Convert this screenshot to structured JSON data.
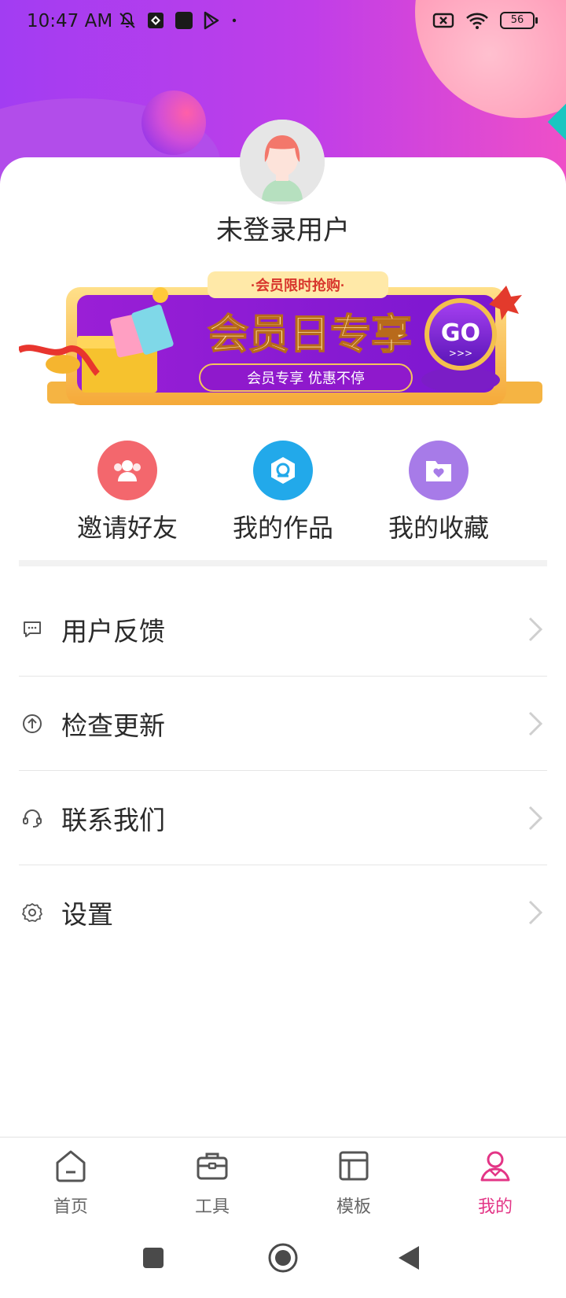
{
  "status_bar": {
    "time": "10:47 AM",
    "battery": "56",
    "icons_left": [
      "mute-icon",
      "app-icon",
      "square-app-icon",
      "play-store-icon",
      "dot-icon"
    ],
    "icons_right": [
      "sim-off-icon",
      "wifi-icon",
      "battery-icon"
    ]
  },
  "profile": {
    "username": "未登录用户"
  },
  "banner": {
    "top_tag": "·会员限时抢购·",
    "title": "会员日专享",
    "subtitle": "会员专享 优惠不停",
    "cta": "GO",
    "cta_arrows": ">>>"
  },
  "quick_actions": [
    {
      "label": "邀请好友",
      "icon": "invite-friends-icon",
      "color": "#f3676d"
    },
    {
      "label": "我的作品",
      "icon": "my-works-icon",
      "color": "#22a9ea"
    },
    {
      "label": "我的收藏",
      "icon": "favorites-icon",
      "color": "#a77be8"
    }
  ],
  "menu": [
    {
      "label": "用户反馈",
      "icon": "feedback-icon"
    },
    {
      "label": "检查更新",
      "icon": "update-icon"
    },
    {
      "label": "联系我们",
      "icon": "headset-icon"
    },
    {
      "label": "设置",
      "icon": "settings-icon"
    }
  ],
  "bottom_nav": [
    {
      "label": "首页",
      "icon": "home-icon",
      "active": false
    },
    {
      "label": "工具",
      "icon": "toolbox-icon",
      "active": false
    },
    {
      "label": "模板",
      "icon": "template-icon",
      "active": false
    },
    {
      "label": "我的",
      "icon": "profile-icon",
      "active": true
    }
  ],
  "colors": {
    "accent": "#e33586",
    "header_start": "#a23df2",
    "header_end": "#ee4fc8"
  }
}
